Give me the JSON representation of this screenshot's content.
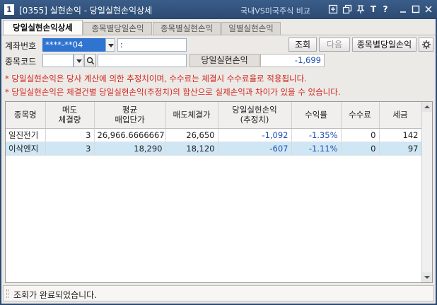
{
  "window": {
    "number": "1",
    "title": "[0355] 실현손익 - 당일실현손익상세",
    "menu_text": "국내VS미국주식 비교"
  },
  "tabs": [
    {
      "label": "당일실현손익상세",
      "active": true
    },
    {
      "label": "종목별당일손익",
      "active": false
    },
    {
      "label": "종목별실현손익",
      "active": false
    },
    {
      "label": "일별실현손익",
      "active": false
    }
  ],
  "form": {
    "account_label": "계좌번호",
    "account_value": "****-**04",
    "account_name": ":",
    "code_label": "종목코드",
    "code_value": "",
    "code_name": "",
    "realized_label": "당일실현손익",
    "realized_value": "-1,699"
  },
  "buttons": {
    "query": "조회",
    "next": "다음",
    "by_stock": "종목별당일손익"
  },
  "notices": [
    "* 당일실현손익은 당사 계산에 의한 추정치이며, 수수료는 체결시 수수료율로 적용됩니다.",
    "* 당일실현손익은 체결건별 당일실현손익(추정치)의 합산으로 실제손익과 차이가 있을 수 있습니다."
  ],
  "table": {
    "headers": [
      [
        "종목명"
      ],
      [
        "매도",
        "체결량"
      ],
      [
        "평균",
        "매입단가"
      ],
      [
        "매도체결가"
      ],
      [
        "당일실현손익",
        "(추정치)"
      ],
      [
        "수익률"
      ],
      [
        "수수료"
      ],
      [
        "세금"
      ]
    ],
    "rows": [
      [
        "일진전기",
        "3",
        "26,966.6666667",
        "26,650",
        "-1,092",
        "-1.35%",
        "0",
        "142"
      ],
      [
        "이삭엔지",
        "3",
        "18,290",
        "18,120",
        "-607",
        "-1.11%",
        "0",
        "97"
      ]
    ]
  },
  "status": "조회가 완료되었습니다."
}
